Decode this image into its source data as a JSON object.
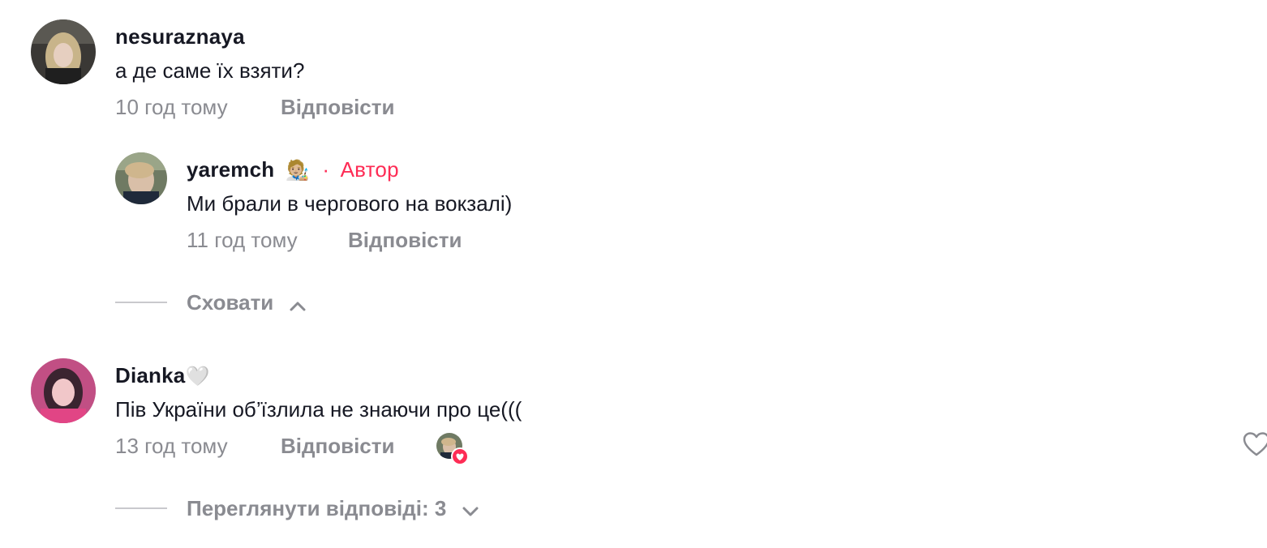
{
  "comments": [
    {
      "username": "nesuraznaya",
      "text": "а де саме їх взяти?",
      "time": "10 год тому",
      "reply_label": "Відповісти",
      "reply": {
        "username": "yaremch",
        "emoji": "🧑🏼‍🎨",
        "dot": "·",
        "author_label": "Автор",
        "text": "Ми брали в чергового на вокзалі)",
        "time": "11 год тому",
        "reply_label": "Відповісти"
      },
      "toggle_label": "Сховати"
    },
    {
      "username": "Dianka",
      "username_emoji": "🤍",
      "text": "Пів України об’їзлила не знаючи про це(((",
      "time": "13 год тому",
      "reply_label": "Відповісти",
      "toggle_label": "Переглянути відповіді: 3"
    }
  ],
  "icons": {
    "chevron_up": "chevron-up-icon",
    "chevron_down": "chevron-down-icon",
    "heart": "heart-outline-icon",
    "liked_by_creator": "liked-by-creator-icon"
  },
  "colors": {
    "author_accent": "#fe2c55",
    "meta_gray": "#8a8b91",
    "text_dark": "#161823"
  }
}
